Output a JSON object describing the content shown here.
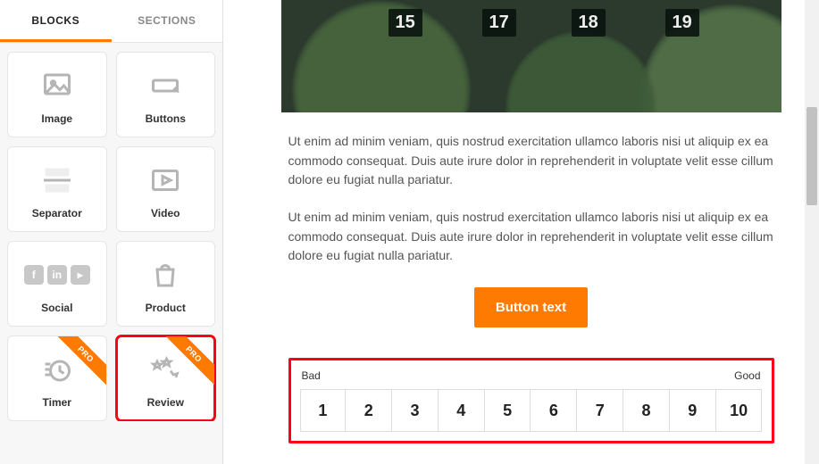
{
  "sidebar": {
    "tabs": {
      "blocks": "BLOCKS",
      "sections": "SECTIONS"
    },
    "blocks": [
      {
        "label": "Image",
        "icon": "image-icon",
        "pro": false
      },
      {
        "label": "Buttons",
        "icon": "buttons-icon",
        "pro": false
      },
      {
        "label": "Separator",
        "icon": "separator-icon",
        "pro": false
      },
      {
        "label": "Video",
        "icon": "video-icon",
        "pro": false
      },
      {
        "label": "Social",
        "icon": "social-icon",
        "pro": false
      },
      {
        "label": "Product",
        "icon": "product-icon",
        "pro": false
      },
      {
        "label": "Timer",
        "icon": "timer-icon",
        "pro": true
      },
      {
        "label": "Review",
        "icon": "review-icon",
        "pro": true,
        "highlight": true
      }
    ],
    "pro_label": "PRO"
  },
  "canvas": {
    "hero_signs": [
      "15",
      "17",
      "18",
      "19"
    ],
    "paragraphs": [
      "Ut enim ad minim veniam, quis nostrud exercitation ullamco laboris nisi ut aliquip ex ea commodo consequat. Duis aute irure dolor in reprehenderit in voluptate velit esse cillum dolore eu fugiat nulla pariatur.",
      "Ut enim ad minim veniam, quis nostrud exercitation ullamco laboris nisi ut aliquip ex ea commodo consequat. Duis aute irure dolor in reprehenderit in voluptate velit esse cillum dolore eu fugiat nulla pariatur."
    ],
    "button_label": "Button text",
    "review": {
      "bad_label": "Bad",
      "good_label": "Good",
      "scale": [
        "1",
        "2",
        "3",
        "4",
        "5",
        "6",
        "7",
        "8",
        "9",
        "10"
      ]
    }
  },
  "colors": {
    "accent": "#ff7a00",
    "highlight": "#ff0017"
  }
}
